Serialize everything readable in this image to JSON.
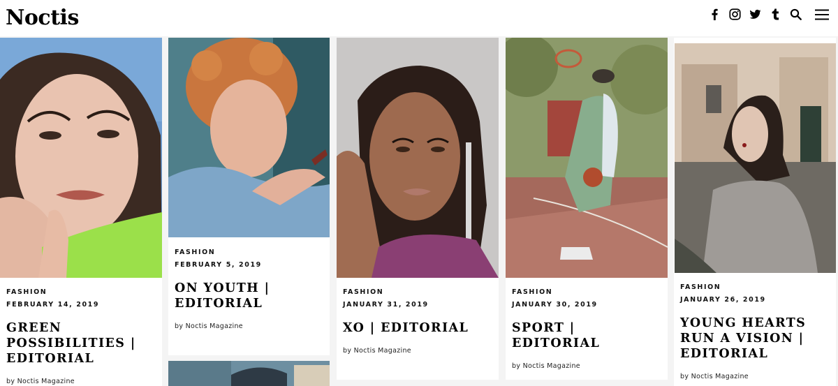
{
  "site": {
    "logo": "Noctis"
  },
  "header_icons": [
    "facebook-icon",
    "instagram-icon",
    "twitter-icon",
    "tumblr-icon",
    "search-icon",
    "menu-icon"
  ],
  "byline_prefix": "by",
  "posts": [
    {
      "category": "FASHION",
      "date": "FEBRUARY 14, 2019",
      "title": "GREEN POSSIBILITIES | EDITORIAL",
      "author": "Noctis Magazine"
    },
    {
      "category": "FASHION",
      "date": "FEBRUARY 5, 2019",
      "title": "ON YOUTH | EDITORIAL",
      "author": "Noctis Magazine"
    },
    {
      "category": "FASHION",
      "date": "JANUARY 31, 2019",
      "title": "XO | EDITORIAL",
      "author": "Noctis Magazine"
    },
    {
      "category": "FASHION",
      "date": "JANUARY 30, 2019",
      "title": "SPORT | EDITORIAL",
      "author": "Noctis Magazine"
    },
    {
      "category": "FASHION",
      "date": "JANUARY 26, 2019",
      "title": "YOUNG HEARTS RUN A VISION | EDITORIAL",
      "author": "Noctis Magazine"
    }
  ]
}
